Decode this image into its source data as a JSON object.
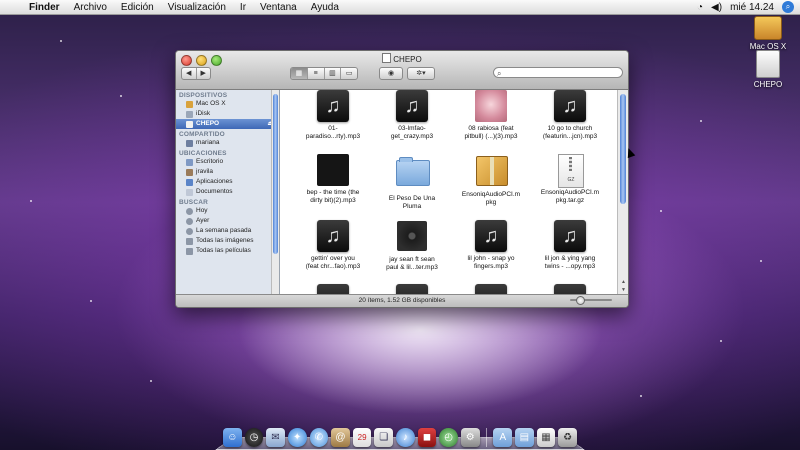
{
  "menubar": {
    "app_name": "Finder",
    "menus": [
      "Archivo",
      "Edición",
      "Visualización",
      "Ir",
      "Ventana",
      "Ayuda"
    ],
    "clock": "mié 14.24"
  },
  "desktop": {
    "icons": [
      {
        "label": "Mac OS X",
        "icon": "hard-drive-icon"
      },
      {
        "label": "CHEPO",
        "icon": "usb-drive-icon"
      }
    ]
  },
  "window": {
    "title": "CHEPO",
    "search": {
      "placeholder": "",
      "value": ""
    },
    "status": "20 ítems, 1.52 GB disponibles"
  },
  "sidebar": {
    "sections": [
      {
        "header": "DISPOSITIVOS",
        "items": [
          {
            "label": "Mac OS X",
            "icon": "hard-drive-icon",
            "selected": false
          },
          {
            "label": "iDisk",
            "icon": "idisk-icon",
            "selected": false
          },
          {
            "label": "CHEPO",
            "icon": "usb-drive-icon",
            "selected": true,
            "eject": true
          }
        ]
      },
      {
        "header": "COMPARTIDO",
        "items": [
          {
            "label": "mariana",
            "icon": "network-computer-icon",
            "selected": false
          }
        ]
      },
      {
        "header": "UBICACIONES",
        "items": [
          {
            "label": "Escritorio",
            "icon": "desktop-icon",
            "selected": false
          },
          {
            "label": "jravila",
            "icon": "home-icon",
            "selected": false
          },
          {
            "label": "Aplicaciones",
            "icon": "applications-icon",
            "selected": false
          },
          {
            "label": "Documentos",
            "icon": "documents-icon",
            "selected": false
          }
        ]
      },
      {
        "header": "BUSCAR",
        "items": [
          {
            "label": "Hoy",
            "icon": "clock-icon",
            "selected": false
          },
          {
            "label": "Ayer",
            "icon": "clock-icon",
            "selected": false
          },
          {
            "label": "La semana pasada",
            "icon": "clock-icon",
            "selected": false
          },
          {
            "label": "Todas las imágenes",
            "icon": "images-icon",
            "selected": false
          },
          {
            "label": "Todas las películas",
            "icon": "movies-icon",
            "selected": false
          }
        ]
      }
    ]
  },
  "files": [
    {
      "line1": "01-",
      "line2": "paradiso...rty).mp3",
      "kind": "music"
    },
    {
      "line1": "03-lmfao-",
      "line2": "get_crazy.mp3",
      "kind": "music"
    },
    {
      "line1": "08 rabiosa (feat",
      "line2": "pitbull) (...)(3).mp3",
      "kind": "art-pink"
    },
    {
      "line1": "10 go to church",
      "line2": "(featurin...jcn).mp3",
      "kind": "music"
    },
    {
      "line1": "bep - the time (the",
      "line2": "dirty bit)(2).mp3",
      "kind": "art-dark"
    },
    {
      "line1": "El Peso De Una",
      "line2": "Pluma",
      "kind": "folder"
    },
    {
      "line1": "EnsoniqAudioPCI.m",
      "line2": "pkg",
      "kind": "package"
    },
    {
      "line1": "EnsoniqAudioPCI.m",
      "line2": "pkg.tar.gz",
      "kind": "archive"
    },
    {
      "line1": "gettin' over you",
      "line2": "(feat chr...fao).mp3",
      "kind": "music"
    },
    {
      "line1": "jay sean ft sean",
      "line2": "paul & lil...ter.mp3",
      "kind": "art-cd"
    },
    {
      "line1": "lil john - snap yo",
      "line2": "fingers.mp3",
      "kind": "music"
    },
    {
      "line1": "lil jon & ying yang",
      "line2": "twins - ...opy.mp3",
      "kind": "music"
    }
  ],
  "dock": {
    "icons": [
      "finder-icon",
      "dashboard-icon",
      "mail-icon",
      "safari-icon",
      "ichat-icon",
      "address-book-icon",
      "ical-icon",
      "preview-icon",
      "itunes-icon",
      "photo-booth-icon",
      "time-machine-icon",
      "system-preferences-icon",
      "separator",
      "applications-folder-icon",
      "documents-folder-icon",
      "downloads-stack-icon",
      "trash-icon"
    ]
  },
  "colors": {
    "selection": "#3e68b6",
    "sidebar_bg": "#dfe5ee"
  }
}
